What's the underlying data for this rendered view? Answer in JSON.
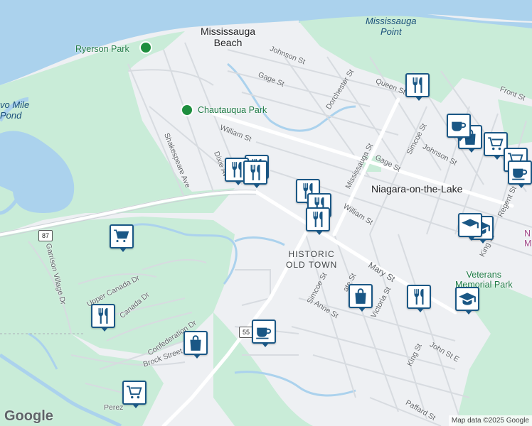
{
  "places": {
    "mississauga_beach": "Mississauga\nBeach",
    "mississauga_point": "Mississauga\nPoint",
    "niagara_on_the_lake": "Niagara-on-the-Lake",
    "historic_old_town": "HISTORIC\nOLD TOWN",
    "two_mile_pond": "vo Mile\nPond",
    "veterans_park": "Veterans\nMemorial Park",
    "museum_partial": "N\nM"
  },
  "parks": {
    "ryerson": "Ryerson Park",
    "chautauqua": "Chautauqua Park"
  },
  "streets": {
    "johnson_st_1": "Johnson St",
    "gage_st_1": "Gage St",
    "dorchester": "Dorchester St",
    "queen": "Queen St",
    "front": "Front St",
    "william_1": "William St",
    "shakespeare": "Shakespeare Ave",
    "dixie": "Dixie Ave",
    "mississauga_st": "Mississauga St",
    "simcoe_1": "Simcoe St",
    "johnson_st_2": "Johnson St",
    "gage_st_2": "Gage St",
    "regent": "Regent St",
    "william_2": "William St",
    "king_1": "King St",
    "mary": "Mary St",
    "simcoe_2": "Simcoe St",
    "gate": "ate St",
    "victoria": "Victoria St",
    "anne": "Anne St",
    "garrison": "Garrison Village Dr",
    "upper_canada": "Upper Canada Dr",
    "canada_dr": "Canada Dr",
    "confederation": "Confederation Dr",
    "brock": "Brock Street",
    "perez": "Perez",
    "king_2": "King St",
    "john": "John St E",
    "paffard": "Paffard St"
  },
  "highways": {
    "h87": "87",
    "h55": "55"
  },
  "attribution": {
    "logo": "Google",
    "copyright": "Map data ©2025 Google"
  },
  "colors": {
    "water": "#abd2ed",
    "park": "#c9ecd8",
    "land": "#eef0f3",
    "road": "#ffffff",
    "marker_border": "#1a5785"
  }
}
